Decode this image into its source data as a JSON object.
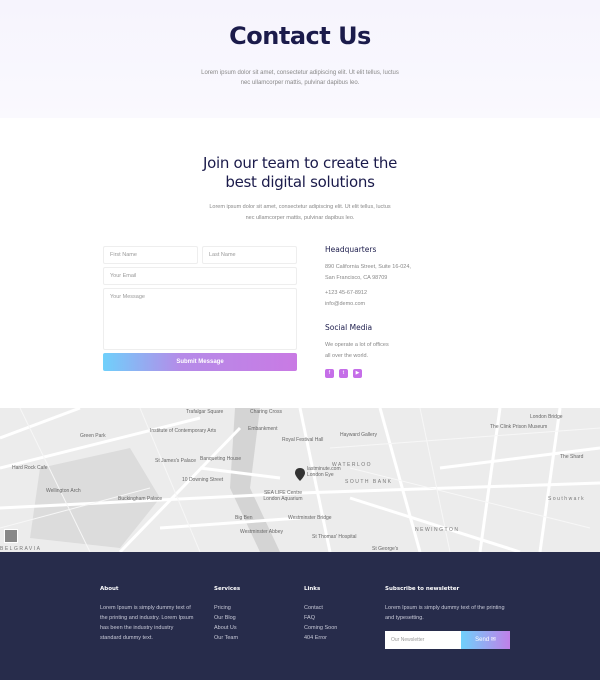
{
  "hero": {
    "title": "Contact Us",
    "text": "Lorem ipsum dolor sit amet, consectetur adipiscing elit. Ut elit tellus, luctus nec ullamcorper mattis, pulvinar dapibus leo."
  },
  "join": {
    "title": "Join our team to create the best digital solutions",
    "text": "Lorem ipsum dolor sit amet, consectetur adipiscing elit. Ut elit tellus, luctus nec ullamcorper mattis, pulvinar dapibus leo."
  },
  "form": {
    "first_name": "First Name",
    "last_name": "Last Name",
    "email": "Your Email",
    "message": "Your Message",
    "submit": "Submit Message"
  },
  "info": {
    "hq_title": "Headquarters",
    "address1": "890 California Street, Suite 16-024,",
    "address2": "San Francisco, CA 98709",
    "phone": "+123 45-67-8912",
    "email": "info@demo.com",
    "social_title": "Social Media",
    "social_text1": "We operate a lot of offices",
    "social_text2": "all over the world.",
    "social_icons": [
      "facebook-icon",
      "twitter-icon",
      "youtube-icon"
    ],
    "accent": "#c56ee8"
  },
  "map": {
    "labels": [
      "Trafalgar Square",
      "Charing Cross",
      "Green Park",
      "Institute of Contemporary Arts",
      "Embankment",
      "Royal Festival Hall",
      "Hayward Gallery",
      "London Bridge",
      "The Clink Prison Museum",
      "Hard Rock Cafe",
      "St James's Palace",
      "Banqueting House",
      "WATERLOO",
      "lastminute.com London Eye",
      "SOUTH BANK",
      "The Shard",
      "10 Downing Street",
      "Wellington Arch",
      "Buckingham Palace",
      "SEA LIFE Centre London Aquarium",
      "Southwark",
      "Big Ben",
      "Westminster Bridge",
      "Westminster Abbey",
      "St Thomas' Hospital",
      "NEWINGTON",
      "BELGRAVIA",
      "St George's"
    ]
  },
  "footer": {
    "about_title": "About",
    "about_text": "Lorem Ipsum is simply dummy text of the printing and industry. Lorem Ipsum has been the industry industry standard dummy text.",
    "services_title": "Services",
    "services": [
      "Pricing",
      "Our Blog",
      "About Us",
      "Our Team"
    ],
    "links_title": "Links",
    "links": [
      "Contact",
      "FAQ",
      "Coming Soon",
      "404 Error"
    ],
    "subscribe_title": "Subscribe to newsletter",
    "subscribe_text": "Lorem Ipsum is simply dummy text of the printing and typesetting.",
    "newsletter_placeholder": "Our Newsletter",
    "send": "Send",
    "bg": "#272c4b"
  }
}
